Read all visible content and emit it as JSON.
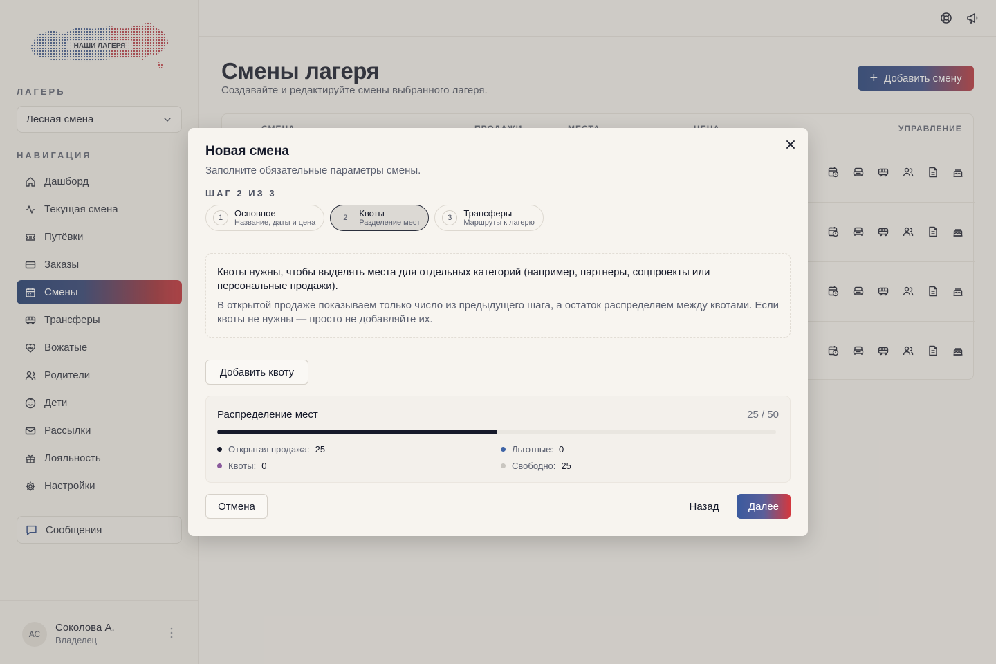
{
  "brand": {
    "logo_text": "НАШИ ЛАГЕРЯ"
  },
  "sidebar": {
    "camp_label": "ЛАГЕРЬ",
    "camp_value": "Лесная смена",
    "nav_label": "НАВИГАЦИЯ",
    "items": [
      {
        "label": "Дашборд",
        "icon": "home-icon"
      },
      {
        "label": "Текущая смена",
        "icon": "activity-icon"
      },
      {
        "label": "Путёвки",
        "icon": "ticket-icon"
      },
      {
        "label": "Заказы",
        "icon": "card-icon"
      },
      {
        "label": "Смены",
        "icon": "calendar-icon",
        "active": true
      },
      {
        "label": "Трансферы",
        "icon": "bus-icon"
      },
      {
        "label": "Вожатые",
        "icon": "heart-icon"
      },
      {
        "label": "Родители",
        "icon": "users-icon"
      },
      {
        "label": "Дети",
        "icon": "child-icon"
      },
      {
        "label": "Рассылки",
        "icon": "mail-icon"
      },
      {
        "label": "Лояльность",
        "icon": "gift-icon"
      },
      {
        "label": "Настройки",
        "icon": "gear-icon"
      }
    ],
    "messages_label": "Сообщения",
    "user": {
      "initials": "АС",
      "name": "Соколова А.",
      "role": "Владелец"
    }
  },
  "main": {
    "title": "Смены лагеря",
    "subtitle": "Создавайте и редактируйте смены выбранного лагеря.",
    "add_button": "Добавить смену",
    "table": {
      "headers": [
        "СМЕНА",
        "ПРОДАЖИ",
        "МЕСТА",
        "ЦЕНА",
        "УПРАВЛЕНИЕ"
      ]
    }
  },
  "modal": {
    "title": "Новая смена",
    "subtitle": "Заполните обязательные параметры смены.",
    "step_label": "ШАГ 2 ИЗ 3",
    "steps": [
      {
        "num": "1",
        "name": "Основное",
        "desc": "Название, даты и цена"
      },
      {
        "num": "2",
        "name": "Квоты",
        "desc": "Разделение мест",
        "active": true
      },
      {
        "num": "3",
        "name": "Трансферы",
        "desc": "Маршруты к лагерю"
      }
    ],
    "info_main": "Квоты нужны, чтобы выделять места для отдельных категорий (например, партнеры, соцпроекты или персональные продажи).",
    "info_hint": "В открытой продаже показываем только число из предыдущего шага, а остаток распределяем между квотами. Если квоты не нужны — просто не добавляйте их.",
    "add_quota": "Добавить квоту",
    "distribution": {
      "title": "Распределение мест",
      "count": "25 / 50",
      "fill_fraction": 0.5,
      "legend": [
        {
          "label": "Открытая продажа:",
          "value": "25",
          "color": "#161a2a"
        },
        {
          "label": "Льготные:",
          "value": "0",
          "color": "#3f64a6"
        },
        {
          "label": "Квоты:",
          "value": "0",
          "color": "#8a5a9c"
        },
        {
          "label": "Свободно:",
          "value": "25",
          "color": "#c9c6c0"
        }
      ]
    },
    "cancel": "Отмена",
    "back": "Назад",
    "next": "Далее"
  }
}
